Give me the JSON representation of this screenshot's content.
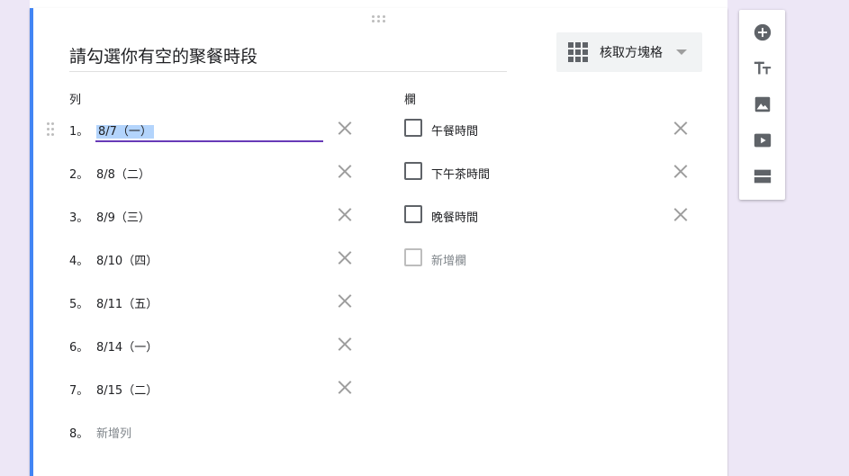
{
  "question": {
    "title": "請勾選你有空的聚餐時段",
    "type_label": "核取方塊格"
  },
  "rows_header": "列",
  "columns_header": "欄",
  "rows": [
    {
      "num": "1。",
      "label": "8/7（一）"
    },
    {
      "num": "2。",
      "label": "8/8（二）"
    },
    {
      "num": "3。",
      "label": "8/9（三）"
    },
    {
      "num": "4。",
      "label": "8/10（四）"
    },
    {
      "num": "5。",
      "label": "8/11（五）"
    },
    {
      "num": "6。",
      "label": "8/14（一）"
    },
    {
      "num": "7。",
      "label": "8/15（二）"
    }
  ],
  "add_row": {
    "num": "8。",
    "label": "新增列"
  },
  "columns": [
    {
      "label": "午餐時間"
    },
    {
      "label": "下午茶時間"
    },
    {
      "label": "晚餐時間"
    }
  ],
  "add_column": {
    "label": "新增欄"
  },
  "sidebar": [
    "add-question-icon",
    "add-title-icon",
    "add-image-icon",
    "add-video-icon",
    "add-section-icon"
  ],
  "colors": {
    "accent": "#673ab7",
    "card_border": "#4285f4",
    "background": "#ede7f6"
  }
}
